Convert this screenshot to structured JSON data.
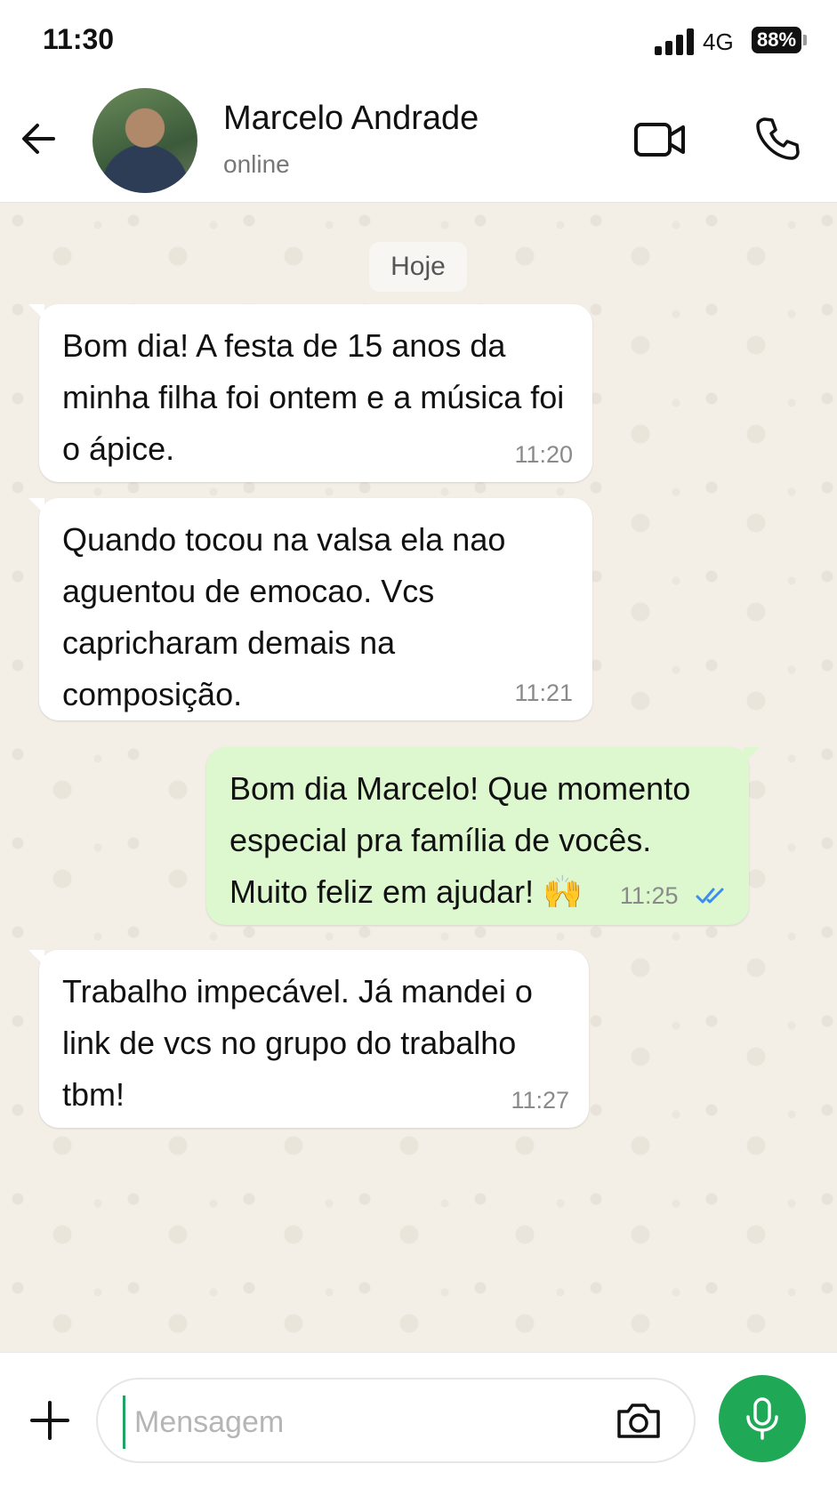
{
  "status_bar": {
    "time": "11:30",
    "network": "4G",
    "battery": "88%"
  },
  "header": {
    "contact_name": "Marcelo Andrade",
    "contact_status": "online",
    "icons": [
      "back-arrow-icon",
      "video-camera-icon",
      "phone-icon"
    ]
  },
  "chat": {
    "date_label": "Hoje",
    "messages": [
      {
        "direction": "incoming",
        "text": "Bom dia! A festa de 15 anos da minha filha foi ontem e a música foi o ápice.",
        "time": "11:20"
      },
      {
        "direction": "incoming",
        "text": "Quando tocou na valsa ela nao aguentou de emocao. Vcs capricharam demais na composição.",
        "time": "11:21"
      },
      {
        "direction": "outgoing",
        "text": "Bom dia Marcelo! Que momento especial pra família de vocês. Muito feliz em ajudar! 🙌",
        "time": "11:25",
        "status": "read"
      },
      {
        "direction": "incoming",
        "text": "Trabalho impecável. Já mandei o link de vcs no grupo do trabalho tbm!",
        "time": "11:27"
      }
    ]
  },
  "composer": {
    "placeholder": "Mensagem",
    "value": "",
    "icons": [
      "plus-icon",
      "camera-icon",
      "microphone-icon"
    ]
  },
  "colors": {
    "outgoing_bubble": "#ddf8cf",
    "incoming_bubble": "#ffffff",
    "accent": "#1fa855",
    "read_ticks": "#3b8ef0"
  }
}
